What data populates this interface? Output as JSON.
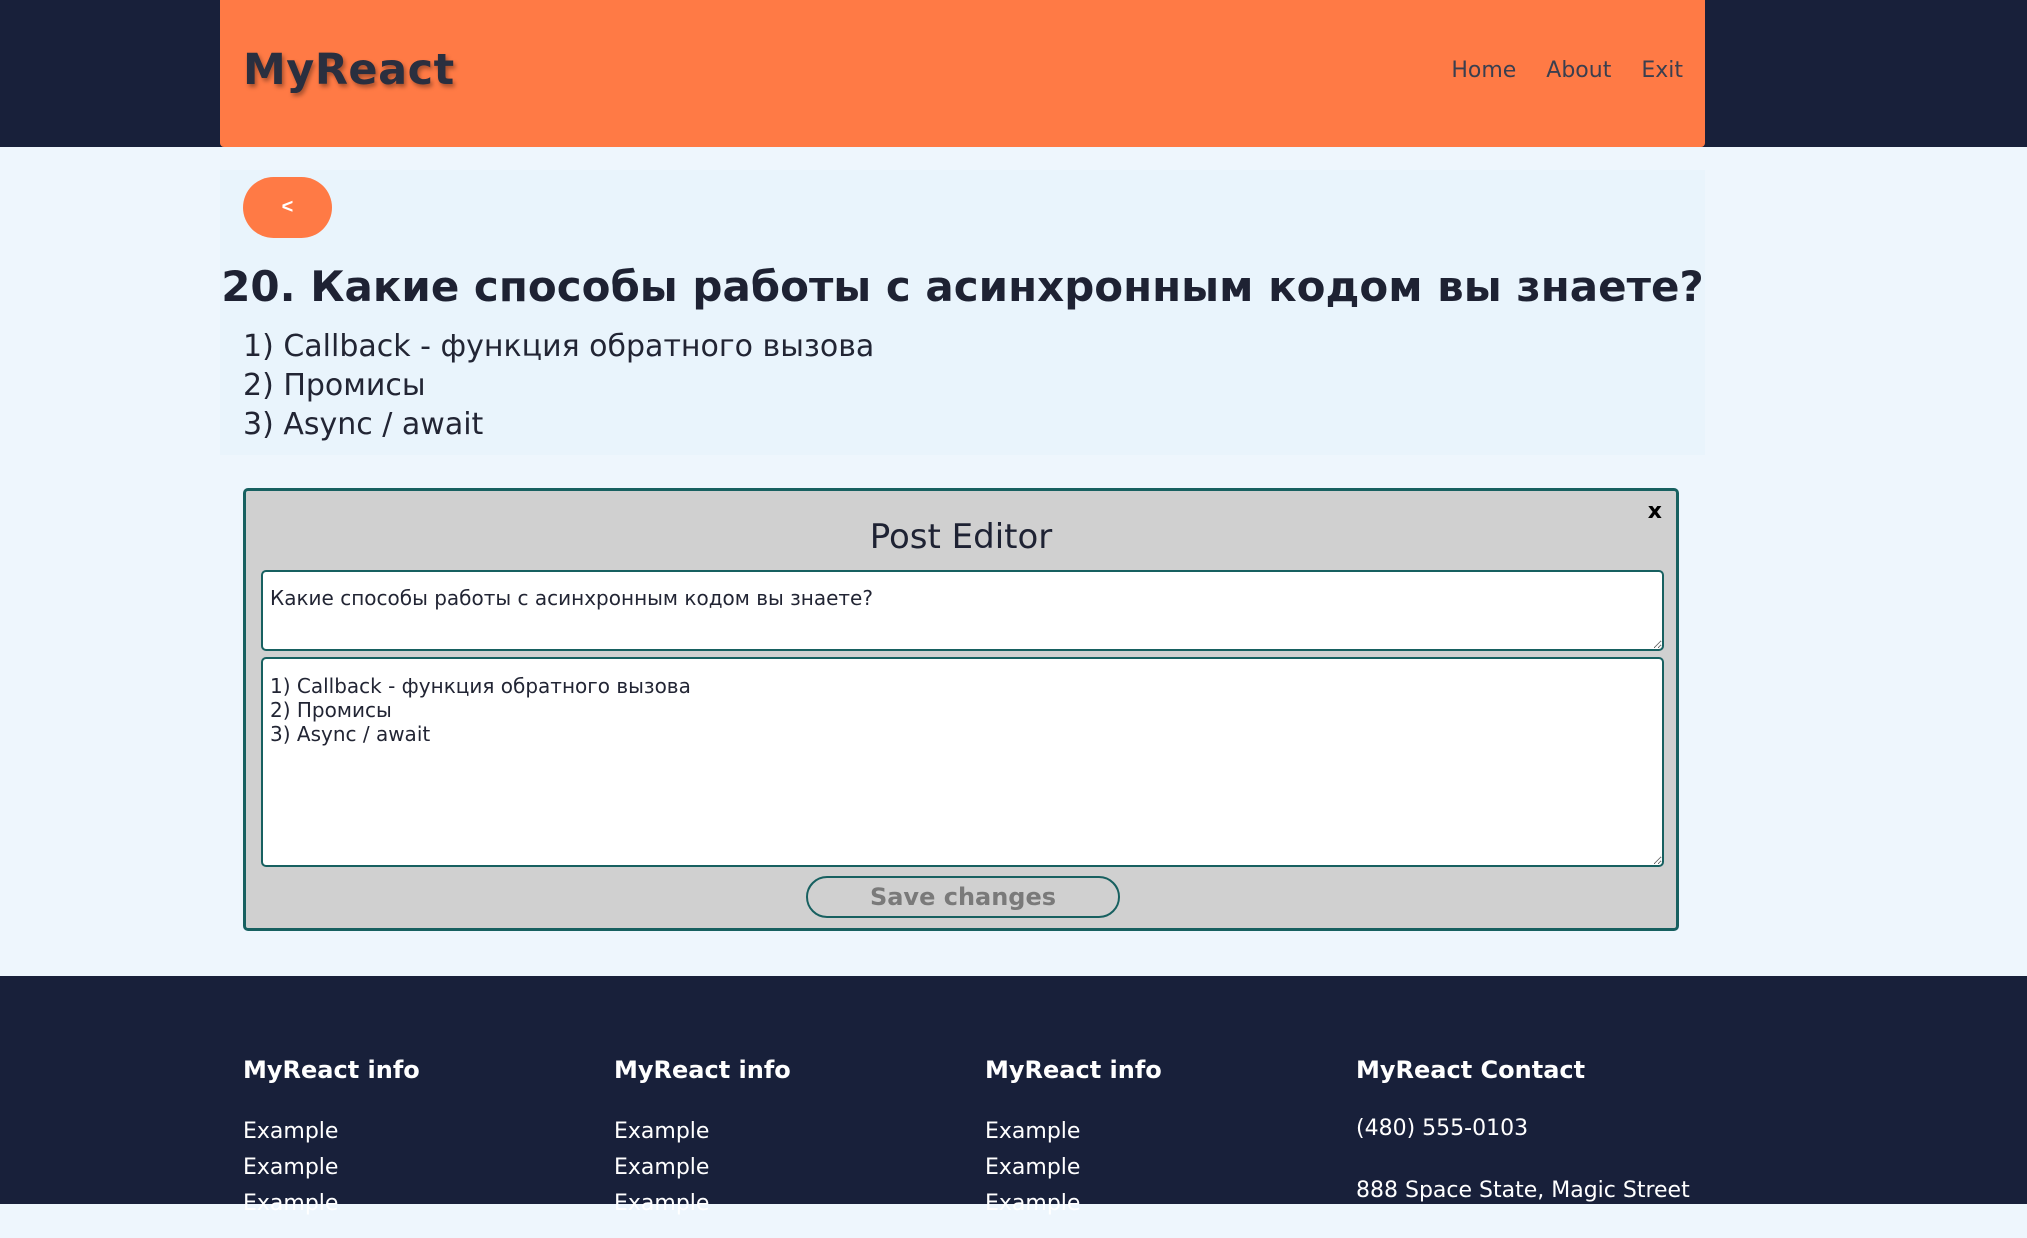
{
  "header": {
    "logo": "MyReact",
    "nav": [
      "Home",
      "About",
      "Exit"
    ]
  },
  "post": {
    "back_label": "<",
    "title": "20. Какие способы работы с асинхронным кодом вы знаете?",
    "body_lines": [
      "1) Callback - функция обратного вызова",
      "2) Промисы",
      "3) Async / await"
    ]
  },
  "editor": {
    "close_label": "x",
    "title": "Post Editor",
    "title_value": "Какие способы работы с асинхронным кодом вы знаете?",
    "body_value": "1) Callback - функция обратного вызова\n2) Промисы\n3) Async / await",
    "save_label": "Save changes"
  },
  "footer": {
    "columns": [
      {
        "heading": "MyReact info",
        "items": [
          "Example",
          "Example",
          "Example"
        ]
      },
      {
        "heading": "MyReact info",
        "items": [
          "Example",
          "Example",
          "Example"
        ]
      },
      {
        "heading": "MyReact info",
        "items": [
          "Example",
          "Example",
          "Example"
        ]
      }
    ],
    "contact": {
      "heading": "MyReact Contact",
      "phone": "(480) 555-0103",
      "address": "888 Space State, Magic Street"
    }
  }
}
